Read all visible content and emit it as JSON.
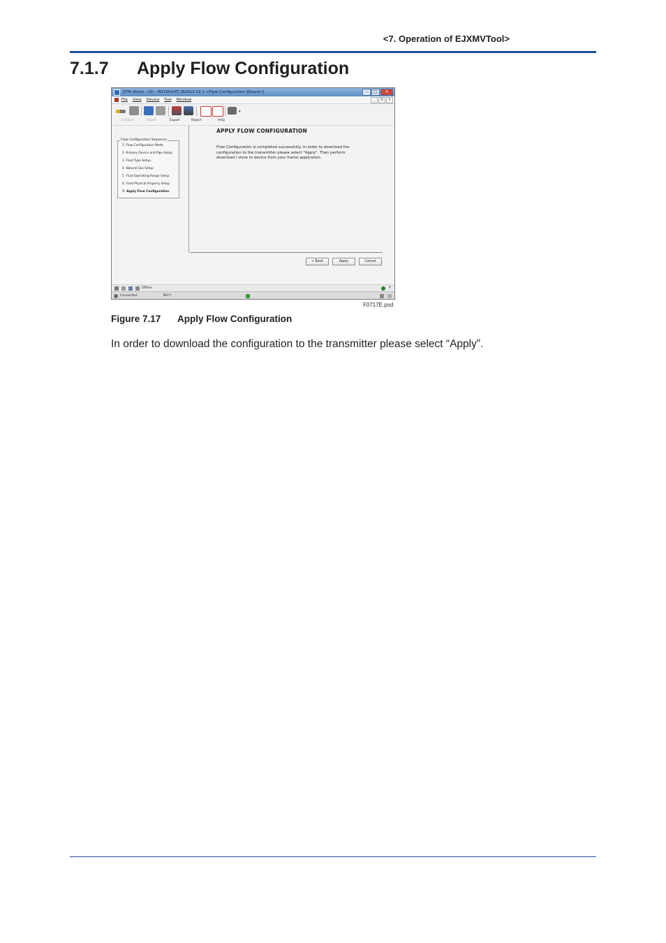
{
  "page": {
    "running_head": "<7.  Operation of EJXMVTool>",
    "section_number": "7.1.7",
    "section_title": "Apply Flow Configuration",
    "figure_number": "Figure 7.17",
    "figure_caption": "Apply Flow Configuration",
    "body_text": "In order to download the configuration to the transmitter please select “Apply”."
  },
  "screenshot": {
    "window_title": "DTM Works - [ID : MV1001HT) EJX910 V2.1 <Flow Configuration Wizard>]",
    "window_buttons": [
      "–",
      "□",
      "×"
    ],
    "menu": [
      "File",
      "View",
      "Device",
      "Tool",
      "Window"
    ],
    "mdi_buttons": [
      "_",
      "⊡",
      "×"
    ],
    "toolbar_captions": {
      "initialize": "Initialize",
      "import": "Import",
      "export": "Export",
      "report": "Report",
      "help": "Help"
    },
    "sequence_legend": "Flow Configuration Sequence",
    "sequence_items": [
      "1. Flow Configuration Mode",
      "2. Primary Device and Pipe Setup",
      "3. Fluid Type Setup",
      "4. Natural Gas Setup",
      "5. Fluid Operating Range Setup",
      "6. Fluid Physical Property Setup",
      "7. Apply Flow Configuration"
    ],
    "heading": "APPLY FLOW CONFIGURATION",
    "message": "Flow Configuration is completed successfully. In order to download the configuration to the transmitter please select \"Apply\". Then perform download / store to device from your frame application.",
    "buttons": {
      "back": "< Back",
      "apply": "Apply",
      "cancel": "Cancel"
    },
    "status_offline": "Offline",
    "status_connected": "Connected",
    "status_user": "BIC/*",
    "file_name": "F0717E.psd",
    "colors": {
      "titlebar": "#5d8cc4",
      "accent_rule": "#1f4e9a"
    }
  }
}
